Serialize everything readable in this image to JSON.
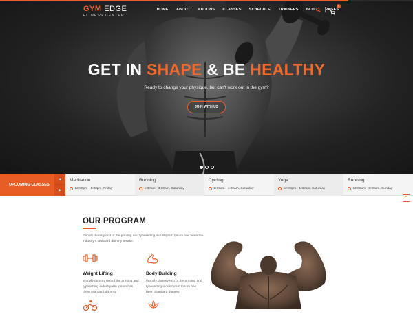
{
  "brand": {
    "name_part1": "GYM",
    "name_part2": " EDGE",
    "tagline": "FITNESS CENTER"
  },
  "nav": {
    "items": [
      "HOME",
      "ABOUT",
      "ADDONS",
      "CLASSES",
      "SCHEDULE",
      "TRAINERS",
      "BLOG",
      "PAGES"
    ],
    "cart_count": "0"
  },
  "hero": {
    "headline_part1": "GET IN ",
    "headline_part2": "SHAPE",
    "headline_part3": " & BE ",
    "headline_part4": "HEALTHY",
    "subtitle": "Ready to change your physique, but can't work out in the gym?",
    "cta_label": "JOIN WITH US",
    "slide_count": 3,
    "active_slide": 1
  },
  "upcoming": {
    "label": "UPCOMING CLASSES",
    "classes": [
      {
        "name": "Meditation",
        "time": "12:00pm - 1:30pm, Friday"
      },
      {
        "name": "Running",
        "time": "1:30am - 3:30am, Saturday"
      },
      {
        "name": "Cycling",
        "time": "2:00am - 4:00am, Saturday"
      },
      {
        "name": "Yoga",
        "time": "12:00pm - 1:30pm, Saturday"
      },
      {
        "name": "Running",
        "time": "12:00am - 2:00am, Sunday"
      }
    ]
  },
  "program": {
    "title": "OUR PROGRAM",
    "description": "Gimply dummy text of the printing and typesetting industryrem Ipsum has been the industry's standard dummy texake.",
    "items": [
      {
        "name": "Weight Lifting",
        "text": "Wimply dummy text of the printing and typesetting industryrem Ipsum has been Standard dummy.",
        "icon": "dumbbell-icon"
      },
      {
        "name": "Body Building",
        "text": "Wimply dummy text of the printing and typesetting industryrem Ipsum has been Standard dummy.",
        "icon": "flexing-arm-icon"
      },
      {
        "icon": "cycling-icon"
      },
      {
        "icon": "lotus-icon"
      }
    ]
  },
  "colors": {
    "accent": "#e85c26",
    "dark": "#222222",
    "bar_bg": "#f4f4f4"
  }
}
